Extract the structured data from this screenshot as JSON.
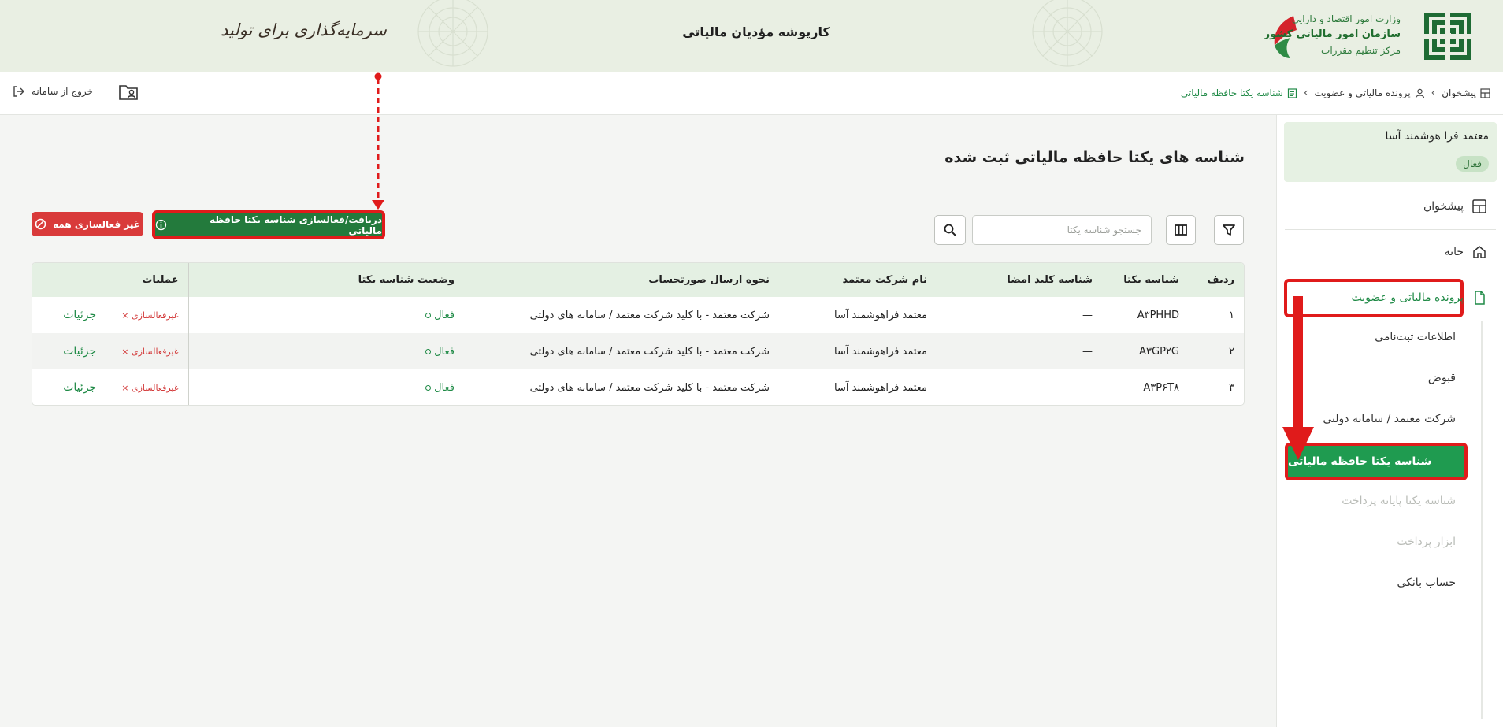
{
  "header": {
    "title": "کارپوشه مؤدیان مالیاتی",
    "slogan": "سرمایه‌گذاری برای تولید",
    "org": {
      "line1": "وزارت امور اقتصاد و دارایی",
      "line2": "سازمان امور مالیاتی کشور",
      "line3": "مرکز تنظیم مقررات"
    }
  },
  "topbar": {
    "logout_label": "خروج از سامانه",
    "breadcrumb": [
      "پیشخوان",
      "پرونده مالیاتی و عضویت",
      "شناسه یکتا حافظه مالیاتی"
    ]
  },
  "sidebar": {
    "user_name": "معتمد فرا هوشمند آسا",
    "user_status": "فعال",
    "items": {
      "dashboard": "پیشخوان",
      "home": "خانه",
      "tax_file": "پرونده مالیاتی و عضویت"
    },
    "sub_items": {
      "registration": "اطلاعات ثبت‌نامی",
      "receipts": "قبوض",
      "trusted_company": "شرکت معتمد / سامانه دولتی",
      "memory_id": "شناسه یکتا حافظه مالیاتی",
      "terminal_id": "شناسه یکتا پایانه پرداخت",
      "payment_tools": "ابزار پرداخت",
      "bank_account": "حساب بانکی"
    }
  },
  "main": {
    "page_title": "شناسه های یکتا حافظه مالیاتی ثبت شده",
    "search_placeholder": "جستجو شناسه یکتا",
    "activate_button": "دریافت/فعالسازی شناسه یکتا حافظه مالیاتی",
    "deactivate_all_button": "غیر فعالسازی همه",
    "table": {
      "headers": [
        "ردیف",
        "شناسه یکتا",
        "شناسه کلید امضا",
        "نام شرکت معتمد",
        "نحوه ارسال صورتحساب",
        "وضعیت شناسه یکتا",
        "عملیات"
      ],
      "rows": [
        [
          "۱",
          "A۳PHHD",
          "—",
          "معتمد فراهوشمند آسا",
          "شرکت معتمد - با کلید شرکت معتمد / سامانه های دولتی",
          "فعال",
          "غیرفعالسازی",
          "جزئیات"
        ],
        [
          "۲",
          "A۳GP۲G",
          "—",
          "معتمد فراهوشمند آسا",
          "شرکت معتمد - با کلید شرکت معتمد / سامانه های دولتی",
          "فعال",
          "غیرفعالسازی",
          "جزئیات"
        ],
        [
          "۳",
          "A۳P۶T۸",
          "—",
          "معتمد فراهوشمند آسا",
          "شرکت معتمد - با کلید شرکت معتمد / سامانه های دولتی",
          "فعال",
          "غیرفعالسازی",
          "جزئیات"
        ]
      ]
    }
  },
  "colors": {
    "accent_green": "#1f9b50",
    "dark_green": "#237a3c",
    "danger_red": "#d93a3a",
    "annotation_red": "#e01b1b",
    "header_bg": "#e9efe3"
  }
}
